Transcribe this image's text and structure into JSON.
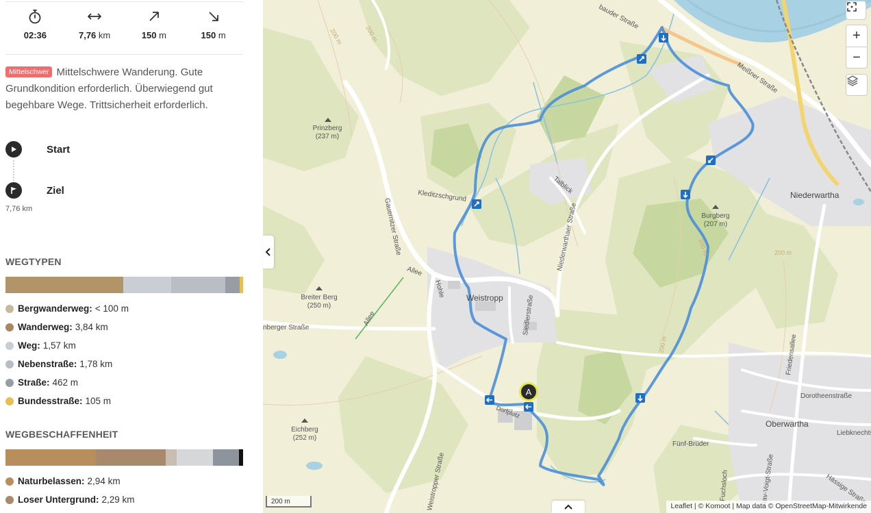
{
  "stats": [
    {
      "icon": "stopwatch-icon",
      "value": "02:36",
      "unit": ""
    },
    {
      "icon": "horizontal-arrows-icon",
      "value": "7,76",
      "unit": "km"
    },
    {
      "icon": "arrow-up-right-icon",
      "value": "150",
      "unit": "m"
    },
    {
      "icon": "arrow-down-right-icon",
      "value": "150",
      "unit": "m"
    }
  ],
  "difficulty": {
    "badge": "Mittelschwer",
    "badge_color": "#ef6d6d",
    "text": "Mittelschwere Wanderung. Gute Grundkondition erforderlich. Überwiegend gut begehbare Wege. Trittsicherheit erforderlich."
  },
  "waypoints": {
    "start": "Start",
    "end": "Ziel",
    "end_distance": "7,76 km"
  },
  "wegtypen": {
    "title": "WEGTYPEN",
    "segments": [
      {
        "color": "#b39468",
        "share": 0.495
      },
      {
        "color": "#c8ced3",
        "share": 0.202
      },
      {
        "color": "#b8bec3",
        "share": 0.229
      },
      {
        "color": "#969da5",
        "share": 0.06
      },
      {
        "color": "#e6bf55",
        "share": 0.014
      }
    ],
    "items": [
      {
        "label": "Bergwanderweg:",
        "value": "< 100 m",
        "color": "#c8b89e"
      },
      {
        "label": "Wanderweg:",
        "value": "3,84 km",
        "color": "#a8885e"
      },
      {
        "label": "Weg:",
        "value": "1,57 km",
        "color": "#c8ced3"
      },
      {
        "label": "Nebenstraße:",
        "value": "1,78 km",
        "color": "#b8bec3"
      },
      {
        "label": "Straße:",
        "value": "462 m",
        "color": "#969da5"
      },
      {
        "label": "Bundesstraße:",
        "value": "105 m",
        "color": "#e6bf55"
      }
    ]
  },
  "wegbeschaffenheit": {
    "title": "WEGBESCHAFFENHEIT",
    "segments": [
      {
        "color": "#b88f5c",
        "share": 0.379
      },
      {
        "color": "#a8896b",
        "share": 0.295
      },
      {
        "color": "#c8bfb2",
        "share": 0.046
      },
      {
        "color": "#d5d7d9",
        "share": 0.153
      },
      {
        "color": "#8e949c",
        "share": 0.11
      },
      {
        "color": "#111111",
        "share": 0.017
      }
    ],
    "items": [
      {
        "label": "Naturbelassen:",
        "value": "2,94 km",
        "color": "#b88f5c"
      },
      {
        "label": "Loser Untergrund:",
        "value": "2,29 km",
        "color": "#a8896b"
      }
    ]
  },
  "map": {
    "labels": {
      "prinzberg": "Prinzberg",
      "prinzberg_h": "(237 m)",
      "breiter_berg": "Breiter Berg",
      "breiter_berg_h": "(250 m)",
      "eichberg": "Eichberg",
      "eichberg_h": "(252 m)",
      "burgberg": "Burgberg",
      "burgberg_h": "(207 m)",
      "weistropp": "Weistropp",
      "niederwartha": "Niederwartha",
      "oberwartha": "Oberwartha",
      "kleditzschgrund": "Kleditzschgrund",
      "talblick": "Talblick",
      "gauernitzer": "Gauernitzer Straße",
      "niederwarthaer": "Niederwarthaer Straße",
      "siedlerstrasse": "Siedlerstraße",
      "hohle": "Hohle",
      "allee1": "Allee",
      "allee2": "Allee",
      "nberger": "nberger Straße",
      "weistropper": "Weistropper Straße",
      "meissner": "Meißner Straße",
      "bauder": "bauder Straße",
      "friedensallee": "Friedensallee",
      "dorotheen": "Dorotheenstraße",
      "liebknecht": "Liebknechtstr",
      "fuenf_brueder": "Fünf-Brüder",
      "fuchsloch": "Fuchsloch",
      "gustav": "stav-Voigt-Straße",
      "haessige": "Hässige Straße",
      "dorfplatz": "Dorfplatz",
      "c200a": "200 m",
      "c200b": "200 m",
      "c200c": "200 m",
      "c200d": "200 m",
      "c200e": "200 m",
      "marker": "A"
    },
    "scale": "200 m",
    "attribution": {
      "leaflet": "Leaflet",
      "sep1": " | © ",
      "komoot": "Komoot",
      "sep2": " | Map data © ",
      "osm": "OpenStreetMap",
      "rest": "-Mitwirkende"
    },
    "controls": {
      "zoom_in": "+",
      "zoom_out": "−"
    },
    "route_color": "#4a8fd8"
  }
}
